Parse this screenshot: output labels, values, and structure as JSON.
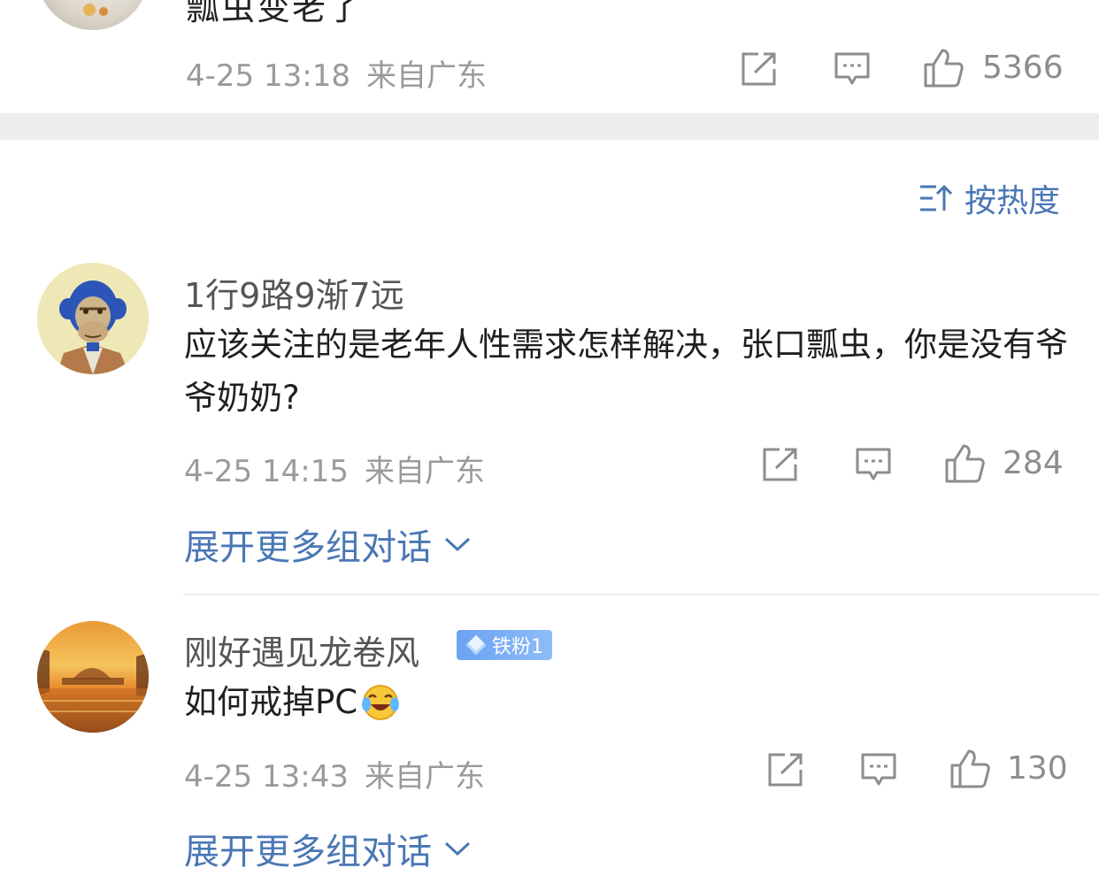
{
  "top_comment": {
    "text": "瓢虫变老了",
    "time": "4-25 13:18",
    "location": "来自广东",
    "likes": "5366"
  },
  "sort": {
    "label": "按热度"
  },
  "comments": [
    {
      "username": "1行9路9渐7远",
      "text": "应该关注的是老年人性需求怎样解决，张口瓢虫，你是没有爷爷奶奶?",
      "time": "4-25 14:15",
      "location": "来自广东",
      "likes": "284",
      "expand_label": "展开更多组对话"
    },
    {
      "username": "刚好遇见龙卷风",
      "badge": "铁粉1",
      "text": "如何戒掉PC",
      "time": "4-25 13:43",
      "location": "来自广东",
      "likes": "130",
      "expand_label": "展开更多组对话"
    }
  ],
  "colors": {
    "link_blue": "#4a77b5",
    "meta_gray": "#9a9a9a",
    "badge_blue": "#6aa3f2"
  }
}
